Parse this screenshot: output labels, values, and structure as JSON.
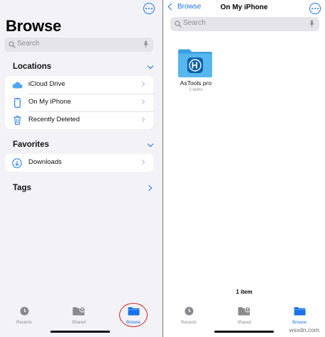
{
  "left": {
    "title": "Browse",
    "search_placeholder": "Search",
    "locations": {
      "header": "Locations",
      "items": [
        {
          "label": "iCloud Drive",
          "icon": "cloud-icon"
        },
        {
          "label": "On My iPhone",
          "icon": "iphone-icon"
        },
        {
          "label": "Recently Deleted",
          "icon": "trash-icon"
        }
      ]
    },
    "favorites": {
      "header": "Favorites",
      "items": [
        {
          "label": "Downloads",
          "icon": "download-icon"
        }
      ]
    },
    "tags": {
      "header": "Tags"
    },
    "tabs": [
      {
        "label": "Recents",
        "icon": "clock-icon",
        "active": false
      },
      {
        "label": "Shared",
        "icon": "shared-folder-icon",
        "active": false
      },
      {
        "label": "Browse",
        "icon": "folder-icon",
        "active": true
      }
    ]
  },
  "right": {
    "back_label": "Browse",
    "title": "On My iPhone",
    "search_placeholder": "Search",
    "folder": {
      "name": "AsTools pro",
      "count": "2 items",
      "icon": "app-folder-icon"
    },
    "item_count": "1 item",
    "tabs": [
      {
        "label": "Recents",
        "icon": "clock-icon",
        "active": false
      },
      {
        "label": "Shared",
        "icon": "shared-folder-icon",
        "active": false
      },
      {
        "label": "Browse",
        "icon": "folder-icon",
        "active": true
      }
    ]
  },
  "watermark": "wsxdn.com",
  "colors": {
    "accent": "#1a73e8",
    "annotation": "#d0211f",
    "folder": "#4fb3ea"
  }
}
